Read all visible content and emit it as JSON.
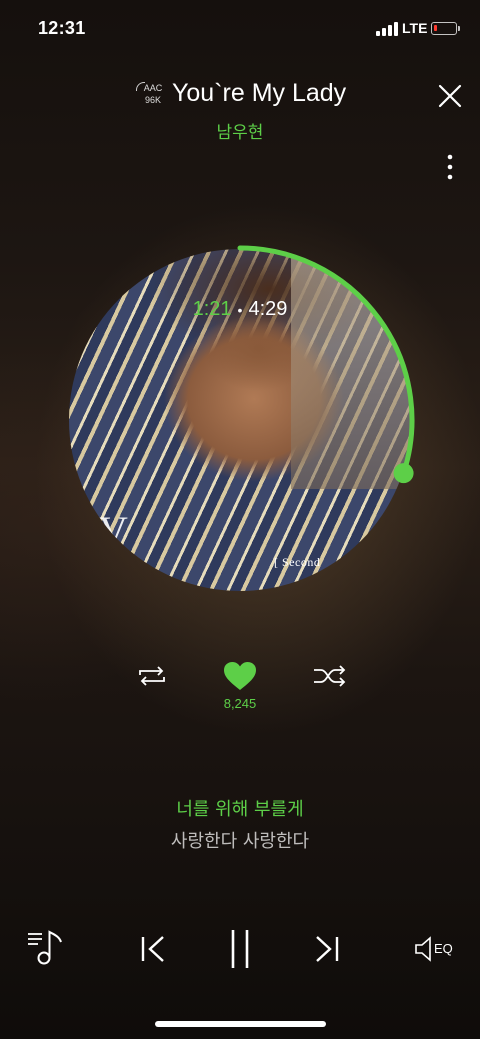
{
  "status_bar": {
    "time": "12:31",
    "network": "LTE",
    "battery_level": 0.15,
    "battery_color": "#ff3b30"
  },
  "header": {
    "quality_codec": "AAC",
    "quality_bitrate": "96K",
    "title": "You`re My Lady",
    "artist": "남우현",
    "close_icon": "close-icon",
    "more_icon": "more-vertical-icon"
  },
  "album": {
    "mark": "V",
    "caption": "[ Second"
  },
  "playback": {
    "current_time": "1:21",
    "separator": "•",
    "total_time": "4:29",
    "progress": 0.3
  },
  "actions": {
    "repeat_icon": "repeat-icon",
    "like_icon": "heart-icon",
    "like_count": "8,245",
    "shuffle_icon": "shuffle-icon"
  },
  "lyrics": {
    "current": "너를 위해 부를게",
    "next": "사랑한다 사랑한다"
  },
  "player": {
    "playlist_icon": "playlist-icon",
    "prev_icon": "previous-icon",
    "pause_icon": "pause-icon",
    "next_icon": "next-icon",
    "eq_label": "EQ"
  },
  "colors": {
    "accent": "#5dcf48",
    "text": "#ffffff"
  }
}
